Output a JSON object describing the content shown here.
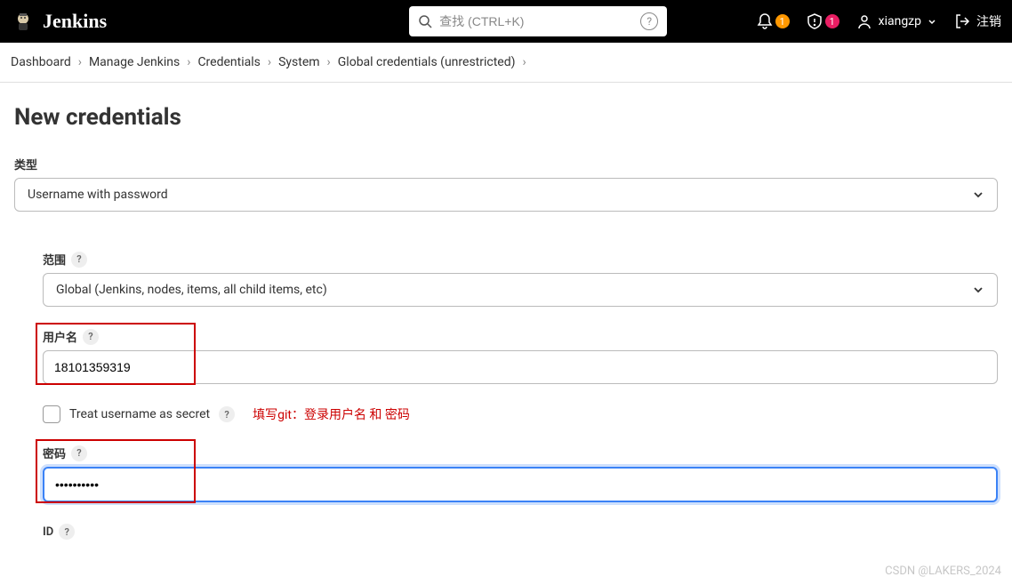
{
  "header": {
    "brand": "Jenkins",
    "search_placeholder": "查找 (CTRL+K)",
    "notif_badge": "1",
    "alert_badge": "1",
    "username": "xiangzp",
    "logout": "注销"
  },
  "breadcrumb": {
    "items": [
      "Dashboard",
      "Manage Jenkins",
      "Credentials",
      "System",
      "Global credentials (unrestricted)"
    ]
  },
  "page": {
    "title": "New credentials",
    "type_label": "类型",
    "type_value": "Username with password",
    "scope_label": "范围",
    "scope_value": "Global (Jenkins, nodes, items, all child items, etc)",
    "username_label": "用户名",
    "username_value": "18101359319",
    "treat_secret_label": "Treat username as secret",
    "annotation": "填写git：登录用户名 和 密码",
    "password_label": "密码",
    "password_value": "••••••••••",
    "id_label": "ID"
  },
  "watermark": "CSDN @LAKERS_2024"
}
